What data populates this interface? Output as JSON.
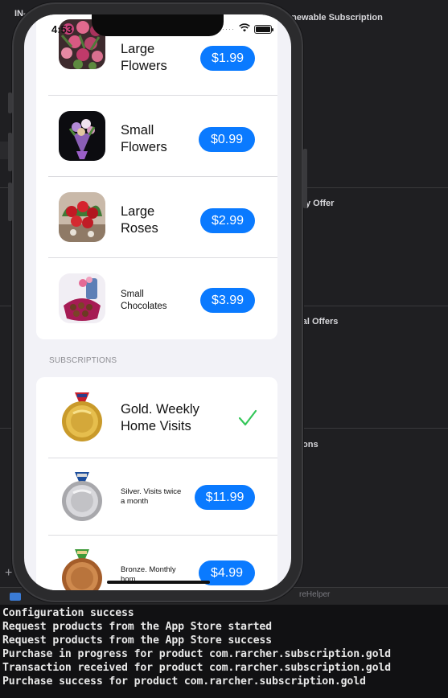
{
  "background": {
    "labels": [
      "IN-",
      "enewable Subscription",
      "ory Offer",
      "nal Offers",
      "ions"
    ],
    "bottom_bar_text": "reHelper",
    "plus_glyph": "+"
  },
  "status_bar": {
    "time": "4:53",
    "signal": "····",
    "wifi": "wifi-icon"
  },
  "products": [
    {
      "title": "Large Flowers",
      "price": "$1.99",
      "icon": "large-flowers-thumbnail"
    },
    {
      "title": "Small Flowers",
      "price": "$0.99",
      "icon": "small-flowers-thumbnail"
    },
    {
      "title": "Large Roses",
      "price": "$2.99",
      "icon": "large-roses-thumbnail"
    },
    {
      "title": "Small Chocolates",
      "price": "$3.99",
      "icon": "small-chocolates-thumbnail"
    }
  ],
  "subscriptions_header": "SUBSCRIPTIONS",
  "subscriptions": [
    {
      "title": "Gold. Weekly Home Visits",
      "price": null,
      "purchased": true,
      "icon": "gold-medal-icon"
    },
    {
      "title": "Silver. Visits twice a month",
      "price": "$11.99",
      "purchased": false,
      "icon": "silver-medal-icon"
    },
    {
      "title": "Bronze. Monthly hom...",
      "price": "$4.99",
      "purchased": false,
      "icon": "bronze-medal-icon"
    }
  ],
  "console": {
    "lines": [
      "Configuration success",
      "Request products from the App Store started",
      "Request products from the App Store success",
      "Purchase in progress for product com.rarcher.subscription.gold",
      "Transaction received for product com.rarcher.subscription.gold",
      "Purchase success for product com.rarcher.subscription.gold"
    ]
  },
  "colors": {
    "accent": "#0a7aff",
    "checkmark": "#34c759",
    "console_bg": "#111113"
  }
}
